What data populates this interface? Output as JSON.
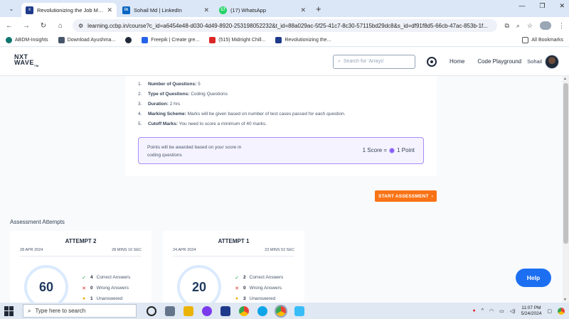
{
  "browser": {
    "tabs": [
      {
        "title": "Revolutionizing the Job Market",
        "active": true,
        "favicon_color": "#1e3a8a",
        "favicon_glyph": "≡"
      },
      {
        "title": "Sohail Md | LinkedIn",
        "active": false,
        "favicon_color": "#0a66c2",
        "favicon_glyph": "in"
      },
      {
        "title": "(17) WhatsApp",
        "active": false,
        "favicon_color": "#25d366",
        "favicon_glyph": "17"
      }
    ],
    "url": "learning.ccbp.in/course?c_id=a6454e48-d030-4d49-8920-253198052232&t_id=88a029ac-5f25-41c7-8c30-57115bd29dc8&s_id=df91f8d5-66cb-47ac-853b-1f...",
    "bookmarks": [
      {
        "label": "ABDM-Insights",
        "color": "#0f766e"
      },
      {
        "label": "Download Ayushma...",
        "color": "#475569"
      },
      {
        "label": "",
        "color": "#1f2937"
      },
      {
        "label": "Freepik | Create gre...",
        "color": "#2563eb"
      },
      {
        "label": "(515) Midnight Chill...",
        "color": "#dc2626"
      },
      {
        "label": "Revolutionizing the...",
        "color": "#1e3a8a"
      }
    ],
    "all_bookmarks": "All Bookmarks"
  },
  "header": {
    "logo_top": "NXT",
    "logo_bottom": "WAVE",
    "logo_tm": "TM",
    "search_placeholder": "Search for 'Arrays'",
    "nav_home": "Home",
    "nav_playground": "Code Playground",
    "user_name": "Sohail"
  },
  "instructions": [
    {
      "num": "1.",
      "key": "Number of Questions:",
      "value": "5"
    },
    {
      "num": "2.",
      "key": "Type of Questions:",
      "value": "Coding Questions"
    },
    {
      "num": "3.",
      "key": "Duration:",
      "value": "2 hrs"
    },
    {
      "num": "4.",
      "key": "Marking Scheme:",
      "value": "Marks will be given based on number of test cases passed for each question."
    },
    {
      "num": "5.",
      "key": "Cutoff Marks:",
      "value": "You need to score a minimum of 40 marks."
    }
  ],
  "points": {
    "text": "Points will be awarded based on your score in coding questions",
    "score_left": "1 Score =",
    "score_right": "1 Point"
  },
  "start_button": "START ASSESSMENT",
  "attempts_title": "Assessment Attempts",
  "attempts": [
    {
      "title": "ATTEMPT 2",
      "date": "28 APR 2024",
      "duration": "28 MINS 16 SEC",
      "score": "60",
      "correct_count": "4",
      "wrong_count": "0",
      "unanswered_count": "1"
    },
    {
      "title": "ATTEMPT 1",
      "date": "24 APR 2024",
      "duration": "23 MINS 52 SEC",
      "score": "20",
      "correct_count": "2",
      "wrong_count": "0",
      "unanswered_count": "3"
    }
  ],
  "stat_labels": {
    "correct": "Correct Answers",
    "wrong": "Wrong Answers",
    "unanswered": "Unanswered"
  },
  "help": "Help",
  "taskbar": {
    "search_placeholder": "Type here to search",
    "time": "11:07 PM",
    "date": "5/24/2024"
  },
  "colors": {
    "accent": "#f97316",
    "help": "#1d6ff2",
    "points_border": "#a78bfa"
  }
}
